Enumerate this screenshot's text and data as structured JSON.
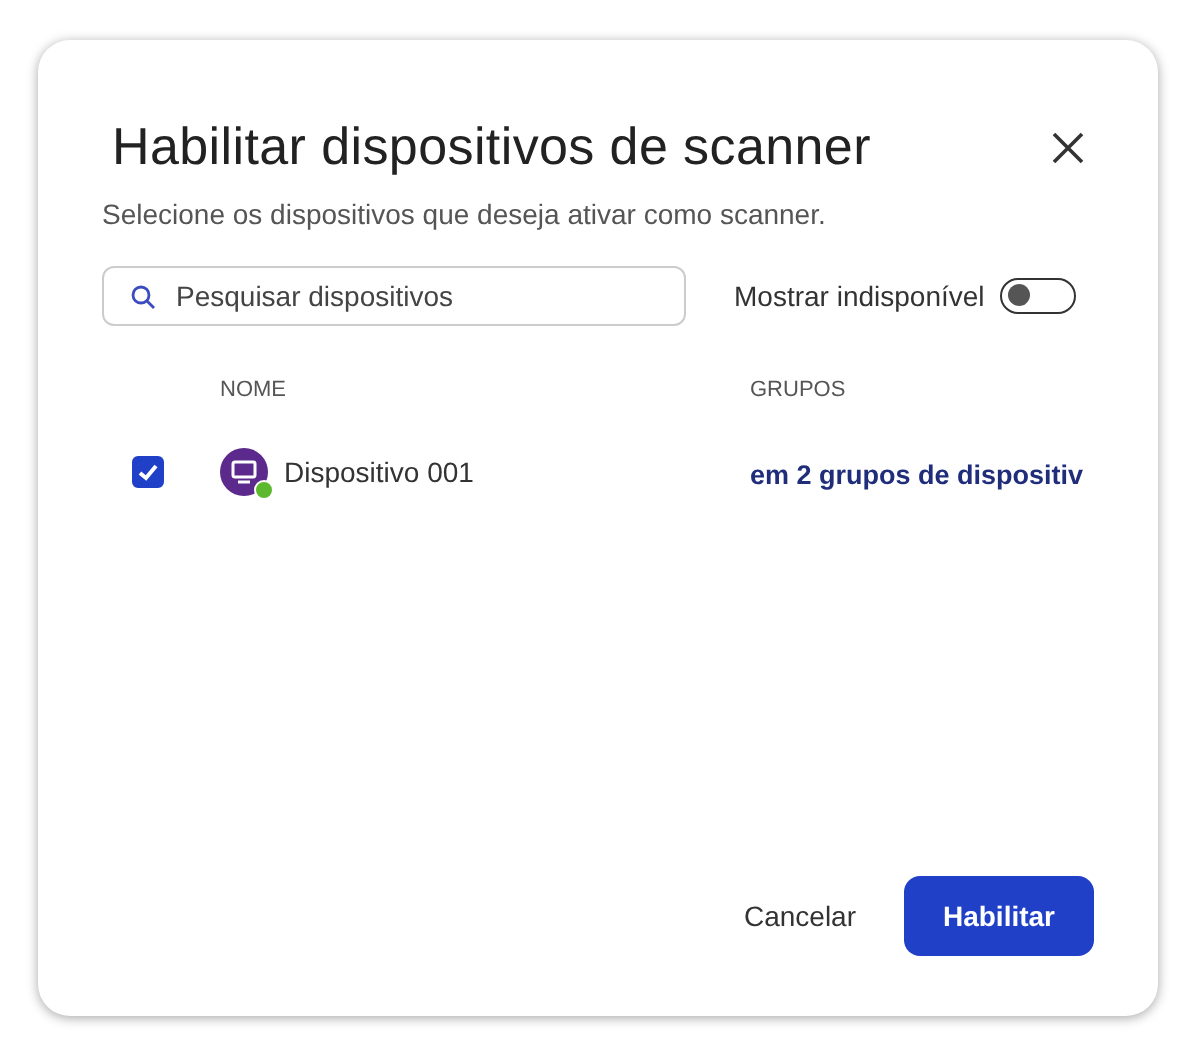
{
  "dialog": {
    "title": "Habilitar dispositivos de scanner",
    "subtitle": "Selecione os dispositivos que deseja ativar como scanner.",
    "search": {
      "placeholder": "Pesquisar dispositivos"
    },
    "toggle": {
      "label": "Mostrar indisponível",
      "on": false
    },
    "table": {
      "columns": [
        "NOME",
        "GRUPOS"
      ],
      "rows": [
        {
          "selected": true,
          "name": "Dispositivo 001",
          "color": "#5cb82f",
          "groups": "em 2 grupos de dispositiv"
        }
      ]
    },
    "buttons": {
      "cancel": "Cancelar",
      "confirm": "Habilitar"
    }
  }
}
